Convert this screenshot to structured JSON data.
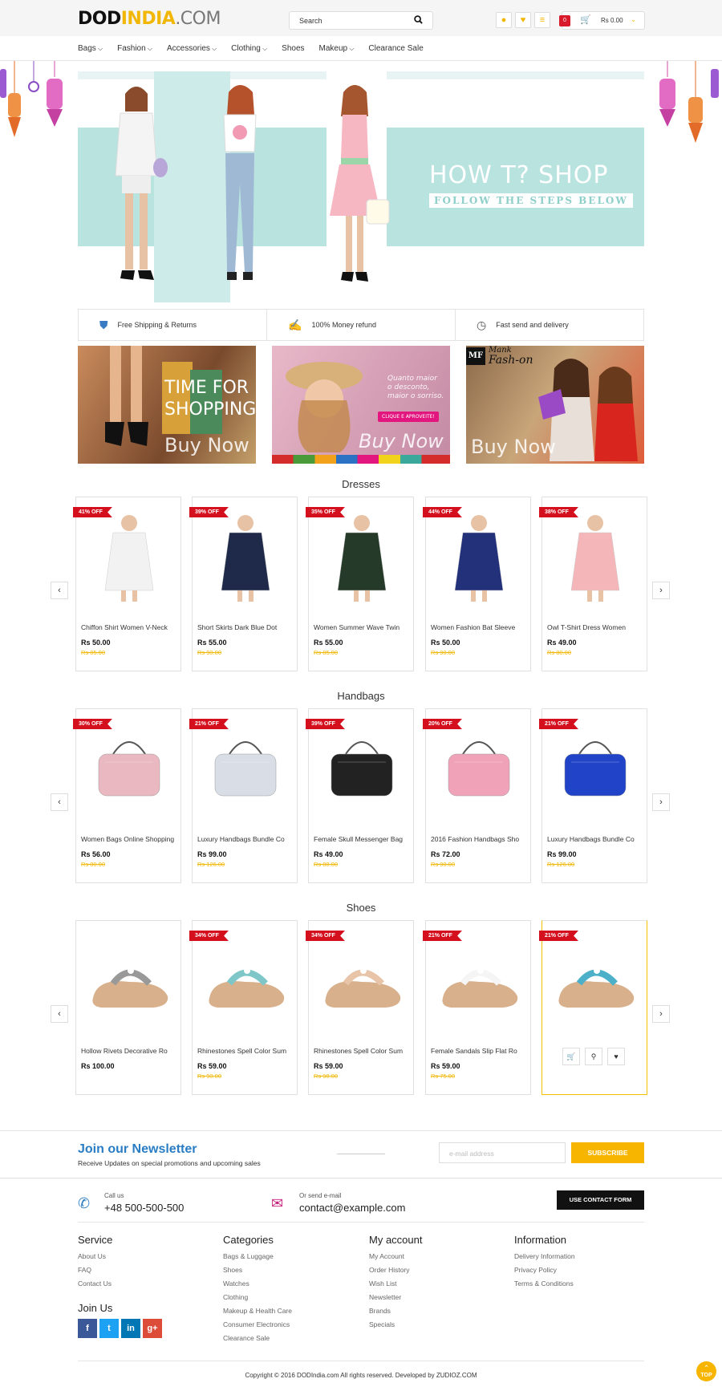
{
  "brand": {
    "part1": "DOD",
    "part2": "INDIA",
    "part3": ".COM"
  },
  "search": {
    "placeholder": "Search"
  },
  "cart": {
    "count": "0",
    "total": "Rs 0.00"
  },
  "nav": [
    "Bags",
    "Fashion",
    "Accessories",
    "Clothing",
    "Shoes",
    "Makeup",
    "Clearance Sale"
  ],
  "nav_dropdown": [
    true,
    true,
    true,
    true,
    false,
    true,
    false
  ],
  "banner": {
    "title": "HOW T? SHOP",
    "subtitle": "FOLLOW THE STEPS BELOW"
  },
  "features": [
    {
      "label": "Free Shipping & Returns",
      "icon": "truck-icon"
    },
    {
      "label": "100% Money refund",
      "icon": "money-hand-icon"
    },
    {
      "label": "Fast send and delivery",
      "icon": "clock-icon"
    }
  ],
  "promos": [
    {
      "line1": "TIME FOR",
      "line2": "SHOPPING",
      "cta": "Buy Now"
    },
    {
      "line1": "Quanto maior",
      "line2": "o desconto,",
      "line3": "maior o sorriso.",
      "tag": "CLIQUE E APROVEITE!",
      "cta": "Buy Now"
    },
    {
      "logo": "MF",
      "logo_text1": "Mank",
      "logo_text2": "Fash-on",
      "cta": "Buy Now"
    }
  ],
  "sections": [
    {
      "title": "Dresses",
      "products": [
        {
          "badge": "41% OFF",
          "name": "Chiffon Shirt Women V-Neck",
          "price": "Rs 50.00",
          "old": "Rs 85.00"
        },
        {
          "badge": "39% OFF",
          "name": "Short Skirts Dark Blue Dot",
          "price": "Rs 55.00",
          "old": "Rs 90.00"
        },
        {
          "badge": "35% OFF",
          "name": "Women Summer Wave Twin",
          "price": "Rs 55.00",
          "old": "Rs 85.00"
        },
        {
          "badge": "44% OFF",
          "name": "Women Fashion Bat Sleeve",
          "price": "Rs 50.00",
          "old": "Rs 90.00"
        },
        {
          "badge": "38% OFF",
          "name": "Owl T-Shirt Dress Women",
          "price": "Rs 49.00",
          "old": "Rs 80.00"
        }
      ]
    },
    {
      "title": "Handbags",
      "products": [
        {
          "badge": "30% OFF",
          "name": "Women Bags Online Shopping",
          "price": "Rs 56.00",
          "old": "Rs 80.00"
        },
        {
          "badge": "21% OFF",
          "name": "Luxury Handbags Bundle Co",
          "price": "Rs 99.00",
          "old": "Rs 126.00"
        },
        {
          "badge": "39% OFF",
          "name": "Female Skull Messenger Bag",
          "price": "Rs 49.00",
          "old": "Rs 80.00"
        },
        {
          "badge": "20% OFF",
          "name": "2016 Fashion Handbags Sho",
          "price": "Rs 72.00",
          "old": "Rs 90.00"
        },
        {
          "badge": "21% OFF",
          "name": "Luxury Handbags Bundle Co",
          "price": "Rs 99.00",
          "old": "Rs 126.00"
        }
      ]
    },
    {
      "title": "Shoes",
      "products": [
        {
          "badge": "",
          "name": "Hollow Rivets Decorative Ro",
          "price": "Rs 100.00",
          "old": ""
        },
        {
          "badge": "34% OFF",
          "name": "Rhinestones Spell Color Sum",
          "price": "Rs 59.00",
          "old": "Rs 90.00"
        },
        {
          "badge": "34% OFF",
          "name": "Rhinestones Spell Color Sum",
          "price": "Rs 59.00",
          "old": "Rs 90.00"
        },
        {
          "badge": "21% OFF",
          "name": "Female Sandals Slip Flat Ro",
          "price": "Rs 59.00",
          "old": "Rs 75.00"
        },
        {
          "badge": "21% OFF",
          "name": "",
          "price": "",
          "old": ""
        }
      ]
    }
  ],
  "newsletter": {
    "title": "Join our Newsletter",
    "text": "Receive Updates on special promotions and upcoming sales",
    "placeholder": "e-mail address",
    "button": "SUBSCRIBE"
  },
  "contact": {
    "call_label": "Call us",
    "phone": "+48 500-500-500",
    "mail_label": "Or send e-mail",
    "email": "contact@example.com",
    "button": "USE CONTACT FORM"
  },
  "footer_cols": [
    {
      "title": "Service",
      "items": [
        "About Us",
        "FAQ",
        "Contact Us"
      ]
    },
    {
      "title": "Categories",
      "items": [
        "Bags & Luggage",
        "Shoes",
        "Watches",
        "Clothing",
        "Makeup & Health Care",
        "Consumer Electronics",
        "Clearance Sale"
      ]
    },
    {
      "title": "My account",
      "items": [
        "My Account",
        "Order History",
        "Wish List",
        "Newsletter",
        "Brands",
        "Specials"
      ]
    },
    {
      "title": "Information",
      "items": [
        "Delivery Information",
        "Privacy Policy",
        "Terms & Conditions"
      ]
    }
  ],
  "join": {
    "title": "Join Us",
    "networks": [
      {
        "icon": "facebook-icon",
        "glyph": "f",
        "color": "#3b5998"
      },
      {
        "icon": "twitter-icon",
        "glyph": "t",
        "color": "#1da1f2"
      },
      {
        "icon": "linkedin-icon",
        "glyph": "in",
        "color": "#0077b5"
      },
      {
        "icon": "google-plus-icon",
        "glyph": "g+",
        "color": "#dd4b39"
      }
    ]
  },
  "copyright": "Copyright © 2016 DODIndia.com All rights reserved. Developed by ZUDIOZ.COM",
  "to_top": "TOP",
  "colors": {
    "accent": "#f7b500",
    "ribbon": "#d40f1e",
    "link": "#2a7dc4",
    "banner": "#b9e3df"
  }
}
